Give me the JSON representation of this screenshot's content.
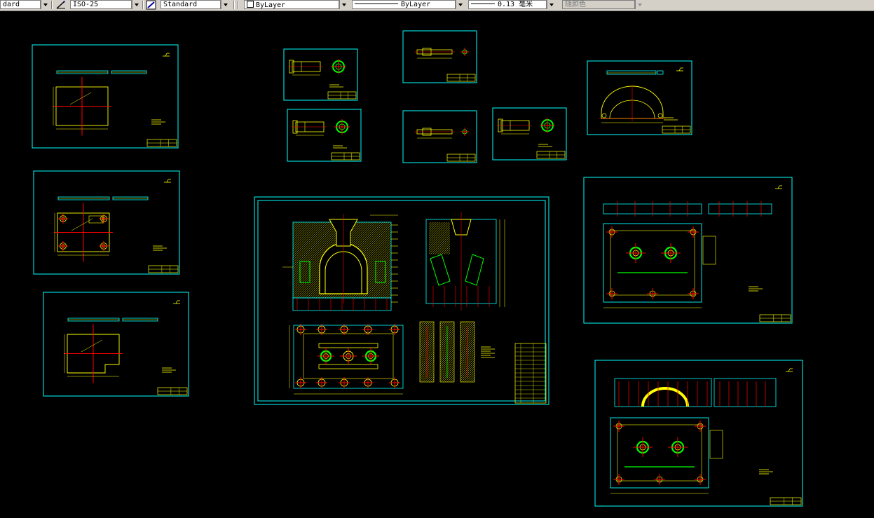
{
  "toolbar": {
    "text_style": "dard",
    "dim_style": "ISO-25",
    "table_style": "Standard",
    "layer": "ByLayer",
    "linetype": "ByLayer",
    "lineweight": "0.13 毫米",
    "plot_style": "随颜色"
  },
  "colors": {
    "background": "#000000",
    "border": "#00ffff",
    "annotation": "#ffff00",
    "centerline": "#ff0000",
    "hole": "#00ff00",
    "hatch": "#ffff00"
  },
  "drawing": {
    "sheets": [
      {
        "id": "sheet-plate-1",
        "kind": "plate"
      },
      {
        "id": "sheet-plate-2",
        "kind": "plate-holes"
      },
      {
        "id": "sheet-plate-3",
        "kind": "plate-step"
      },
      {
        "id": "sheet-pin-1",
        "kind": "pin"
      },
      {
        "id": "sheet-pin-2",
        "kind": "pin"
      },
      {
        "id": "sheet-shaft-1",
        "kind": "shaft"
      },
      {
        "id": "sheet-shaft-2",
        "kind": "shaft"
      },
      {
        "id": "sheet-pin-3",
        "kind": "pin"
      },
      {
        "id": "sheet-arch",
        "kind": "arch"
      },
      {
        "id": "sheet-assembly",
        "kind": "assembly"
      },
      {
        "id": "sheet-template-1",
        "kind": "template"
      },
      {
        "id": "sheet-template-2",
        "kind": "template-arch"
      }
    ]
  }
}
